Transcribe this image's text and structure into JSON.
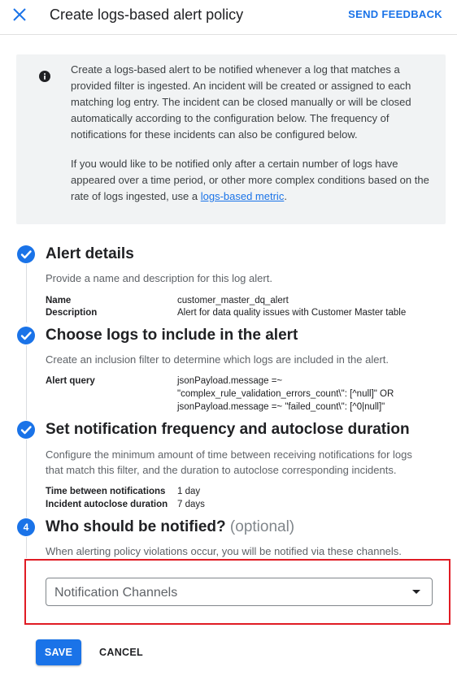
{
  "header": {
    "title": "Create logs-based alert policy",
    "feedback_label": "SEND FEEDBACK"
  },
  "info": {
    "paragraph1": "Create a logs-based alert to be notified whenever a log that matches a provided filter is ingested. An incident will be created or assigned to each matching log entry. The incident can be closed manually or will be closed automatically according to the configuration below. The frequency of notifications for these incidents can also be configured below.",
    "paragraph2_prefix": "If you would like to be notified only after a certain number of logs have appeared over a time period, or other more complex conditions based on the rate of logs ingested, use a ",
    "paragraph2_link": "logs-based metric",
    "paragraph2_suffix": "."
  },
  "steps": [
    {
      "title": "Alert details",
      "description": "Provide a name and description for this log alert.",
      "fields": [
        {
          "label": "Name",
          "value": "customer_master_dq_alert"
        },
        {
          "label": "Description",
          "value": "Alert for data quality issues with Customer Master table"
        }
      ]
    },
    {
      "title": "Choose logs to include in the alert",
      "description": "Create an inclusion filter to determine which logs are included in the alert.",
      "fields": [
        {
          "label": "Alert query",
          "value_lines": [
            "jsonPayload.message =~",
            "\"complex_rule_validation_errors_count\\\": [^null]\" OR",
            "jsonPayload.message =~ \"failed_count\\\": [^0|null]\""
          ]
        }
      ]
    },
    {
      "title": "Set notification frequency and autoclose duration",
      "description_lines": [
        "Configure the minimum amount of time between receiving notifications for logs",
        "that match this filter, and the duration to autoclose corresponding incidents."
      ],
      "fields": [
        {
          "label": "Time between notifications",
          "value": "1 day"
        },
        {
          "label": "Incident autoclose duration",
          "value": "7 days"
        }
      ]
    },
    {
      "number": "4",
      "title": "Who should be notified?",
      "optional_label": "(optional)",
      "description": "When alerting policy violations occur, you will be notified via these channels.",
      "select_label": "Notification Channels"
    }
  ],
  "actions": {
    "save_label": "SAVE",
    "cancel_label": "CANCEL"
  },
  "colors": {
    "primary": "#1a73e8",
    "highlight": "#e01b24"
  }
}
